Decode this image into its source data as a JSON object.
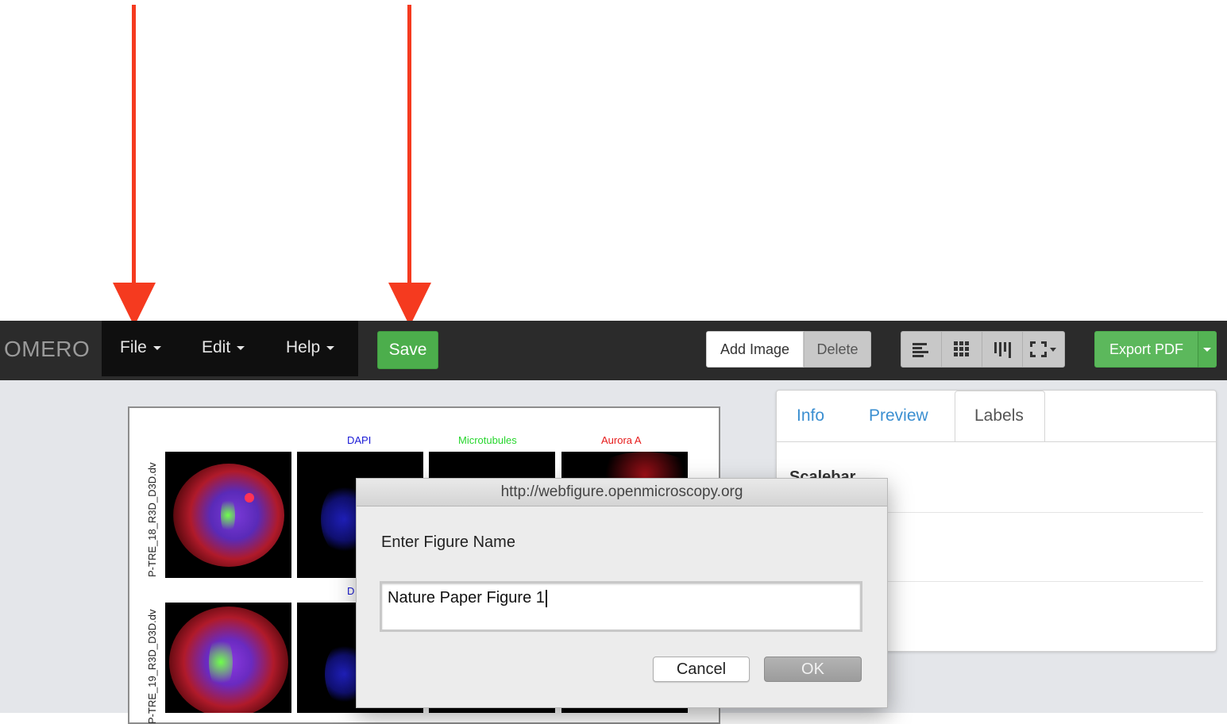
{
  "navbar": {
    "brand": "OMERO",
    "menus": [
      {
        "label": "File"
      },
      {
        "label": "Edit"
      },
      {
        "label": "Help"
      }
    ],
    "save_label": "Save",
    "add_image_label": "Add Image",
    "delete_label": "Delete",
    "export_label": "Export PDF",
    "layout_tools": [
      "align-left-icon",
      "grid-icon",
      "distribute-icon",
      "resize-icon"
    ]
  },
  "figure": {
    "channels": [
      {
        "label": "DAPI",
        "color": "#1a1ad6"
      },
      {
        "label": "Microtubules",
        "color": "#27d62d"
      },
      {
        "label": "Aurora A",
        "color": "#e61a1a"
      }
    ],
    "rows": [
      {
        "label": "P-TRE_18_R3D_D3D.dv"
      },
      {
        "label": "P-TRE_19_R3D_D3D.dv"
      }
    ],
    "partial_channel_label": "D"
  },
  "side_panel": {
    "tabs": [
      {
        "label": "Info"
      },
      {
        "label": "Preview"
      },
      {
        "label": "Labels"
      }
    ],
    "active_tab": "Labels",
    "section_title": "Scalebar"
  },
  "dialog": {
    "title": "http://webfigure.openmicroscopy.org",
    "prompt": "Enter Figure Name",
    "input_value": "Nature Paper Figure 1",
    "cancel_label": "Cancel",
    "ok_label": "OK"
  },
  "colors": {
    "annotation_arrow": "#f53a1f",
    "save_button": "#4cae4c",
    "tab_link": "#3b8fd1"
  }
}
